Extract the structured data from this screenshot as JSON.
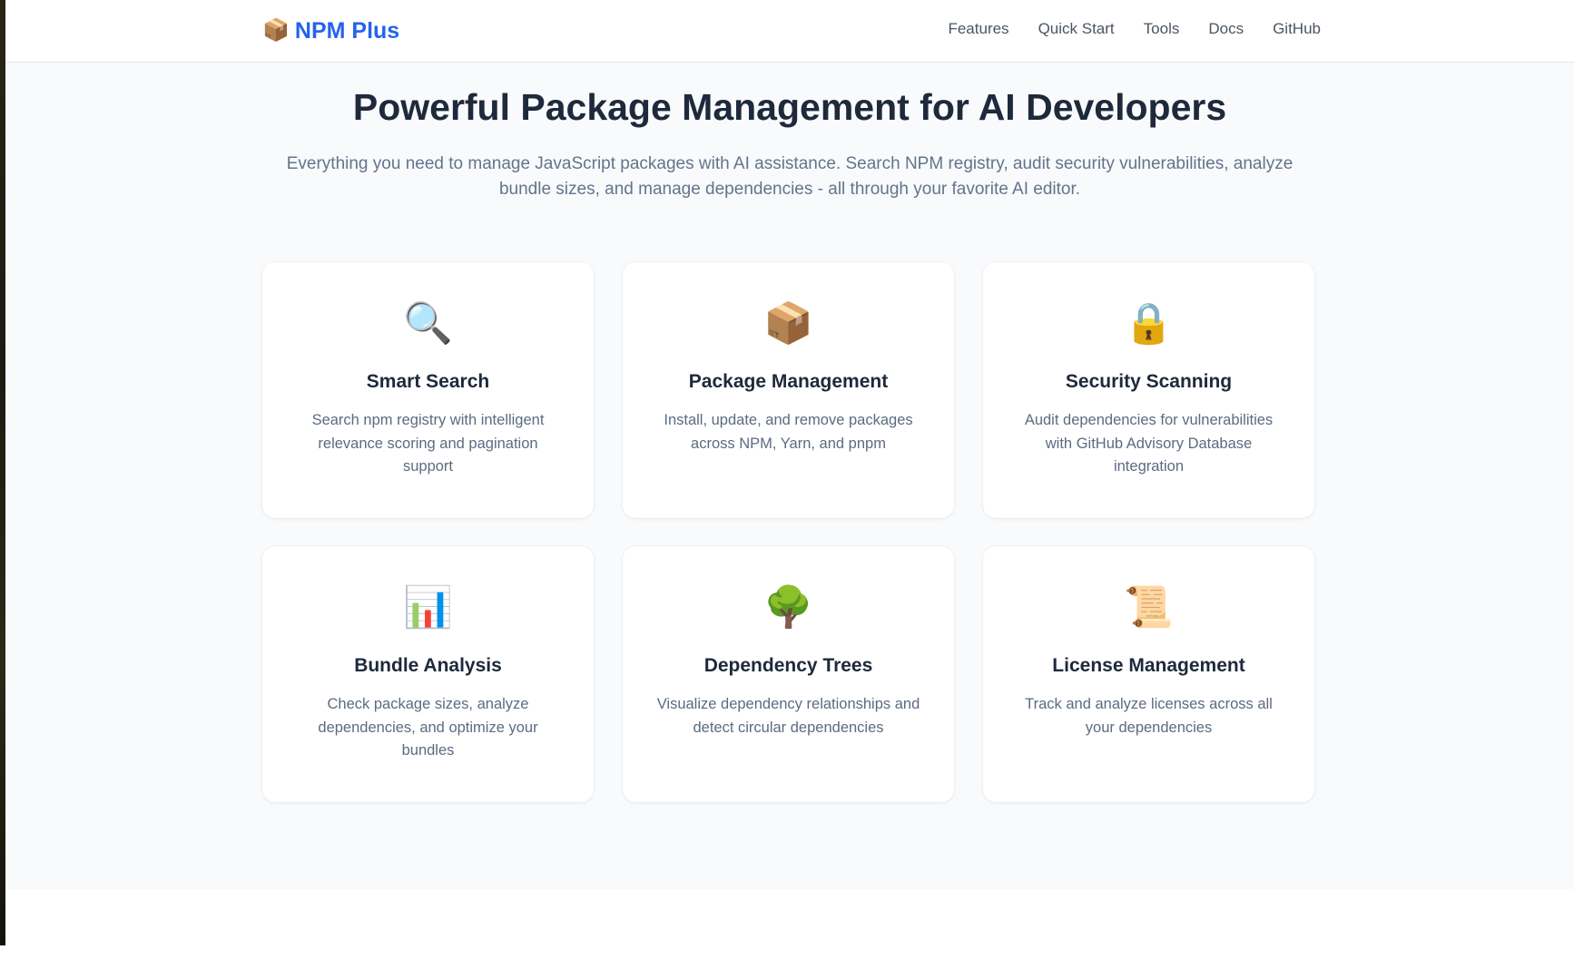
{
  "header": {
    "brand": {
      "icon": "package-icon",
      "glyph": "📦",
      "name": "NPM Plus"
    },
    "nav": [
      {
        "label": "Features"
      },
      {
        "label": "Quick Start"
      },
      {
        "label": "Tools"
      },
      {
        "label": "Docs"
      },
      {
        "label": "GitHub"
      }
    ]
  },
  "hero": {
    "title": "Powerful Package Management for AI Developers",
    "subtitle": "Everything you need to manage JavaScript packages with AI assistance. Search NPM registry, audit security vulnerabilities, analyze bundle sizes, and manage dependencies - all through your favorite AI editor."
  },
  "features": [
    {
      "icon": "magnifying-glass-icon",
      "glyph": "🔍",
      "title": "Smart Search",
      "description": "Search npm registry with intelligent relevance scoring and pagination support"
    },
    {
      "icon": "package-icon",
      "glyph": "📦",
      "title": "Package Management",
      "description": "Install, update, and remove packages across NPM, Yarn, and pnpm"
    },
    {
      "icon": "lock-icon",
      "glyph": "🔒",
      "title": "Security Scanning",
      "description": "Audit dependencies for vulnerabilities with GitHub Advisory Database integration"
    },
    {
      "icon": "bar-chart-icon",
      "glyph": "📊",
      "title": "Bundle Analysis",
      "description": "Check package sizes, analyze dependencies, and optimize your bundles"
    },
    {
      "icon": "tree-icon",
      "glyph": "🌳",
      "title": "Dependency Trees",
      "description": "Visualize dependency relationships and detect circular dependencies"
    },
    {
      "icon": "scroll-icon",
      "glyph": "📜",
      "title": "License Management",
      "description": "Track and analyze licenses across all your dependencies"
    }
  ],
  "colors": {
    "brand": "#2563eb",
    "heading": "#1e293b",
    "muted": "#64748b",
    "hero_background": "#f8fafc",
    "card_background": "#ffffff"
  }
}
